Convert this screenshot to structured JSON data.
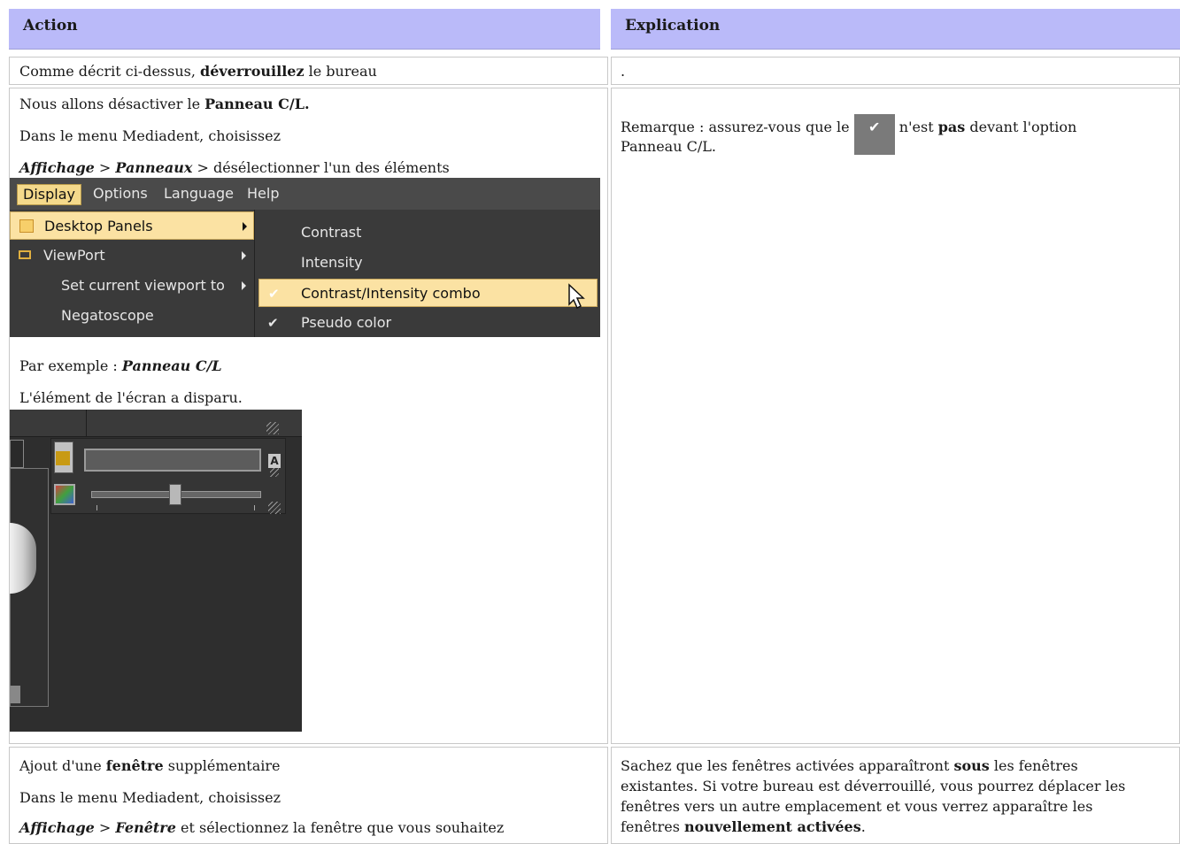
{
  "header": {
    "action": "Action",
    "explication": "Explication"
  },
  "rows": [
    {
      "action": {
        "pre": "Comme décrit ci-dessus, ",
        "bold": "déverrouillez",
        "post": " le bureau"
      },
      "explication": "."
    },
    {
      "action": {
        "line1_pre": "Nous allons désactiver le ",
        "line1_bold": "Panneau C/L.",
        "line2": "Dans le menu Mediadent, choisissez",
        "line3_a": "Affichage",
        "line3_sep1": " > ",
        "line3_b": "Panneaux",
        "line3_post": " > désélectionner l'un des éléments",
        "example_pre": "Par exemple : ",
        "example_bold": "Panneau C/L",
        "result": "L'élément de l'écran a disparu."
      },
      "explication": {
        "pre": "Remarque : assurez-vous que le ",
        "mid": " n'est ",
        "bold": "pas",
        "post": " devant l'option",
        "line2": "Panneau C/L."
      }
    },
    {
      "action": {
        "line1_pre": "Ajout d'une ",
        "line1_bold": "fenêtre",
        "line1_post": " supplémentaire",
        "line2": "Dans le menu Mediadent, choisissez",
        "line3_a": "Affichage",
        "line3_sep": " > ",
        "line3_b": "Fenêtre",
        "line3_post": " et sélectionnez la fenêtre que vous souhaitez"
      },
      "explication": {
        "l1_pre": "Sachez que les fenêtres activées apparaîtront ",
        "l1_bold": "sous",
        "l1_post": " les fenêtres",
        "l2": "existantes. Si votre bureau est déverrouillé, vous pourrez déplacer les",
        "l3": "fenêtres vers un autre emplacement et vous verrez apparaître les",
        "l4_pre": "fenêtres ",
        "l4_bold": "nouvellement activées",
        "l4_post": "."
      }
    }
  ],
  "menu_screenshot": {
    "menubar": [
      "Display",
      "Options",
      "Language",
      "Help"
    ],
    "left_items": [
      "Desktop Panels",
      "ViewPort",
      "Set current viewport to",
      "Negatoscope"
    ],
    "right_items": [
      {
        "label": "Contrast",
        "checked": false
      },
      {
        "label": "Intensity",
        "checked": false
      },
      {
        "label": "Contrast/Intensity combo",
        "checked": true
      },
      {
        "label": "Pseudo color",
        "checked": true
      }
    ],
    "colors": {
      "highlight": "#fbe2a3",
      "bar": "#4a4a4a",
      "menu": "#3a3a3a"
    }
  },
  "panel_screenshot": {
    "badge": "A"
  },
  "colors": {
    "header_bg": "#babaf9",
    "border": "#c8c8c8"
  }
}
